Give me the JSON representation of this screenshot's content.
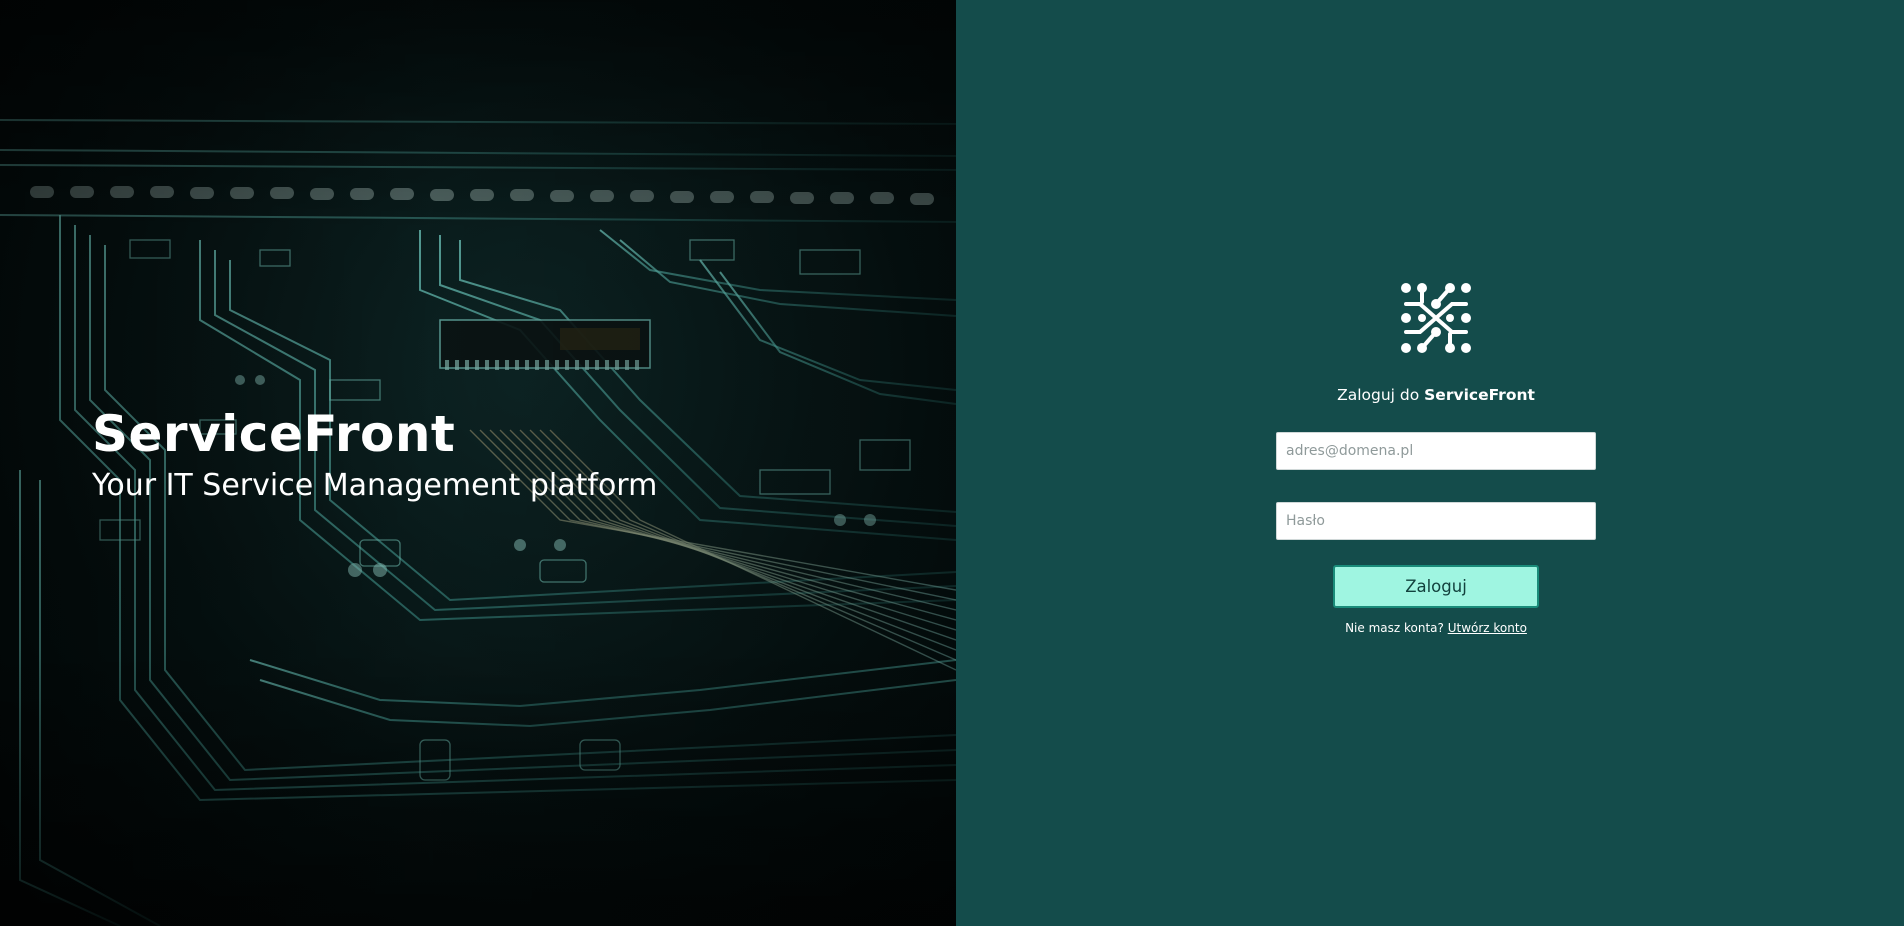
{
  "hero": {
    "title": "ServiceFront",
    "subtitle": "Your IT Service Management platform"
  },
  "login": {
    "logo_icon": "network-nodes-icon",
    "heading_prefix": "Zaloguj do ",
    "heading_brand": "ServiceFront",
    "email_placeholder": "adres@domena.pl",
    "password_placeholder": "Hasło",
    "submit_label": "Zaloguj",
    "signup_prompt": "Nie masz konta? ",
    "signup_link": "Utwórz konto"
  },
  "colors": {
    "panel_bg": "#144c4b",
    "button_bg": "#9ff5e1",
    "button_border": "#1a8c7a",
    "accent_cyan": "#5fd6c8"
  }
}
